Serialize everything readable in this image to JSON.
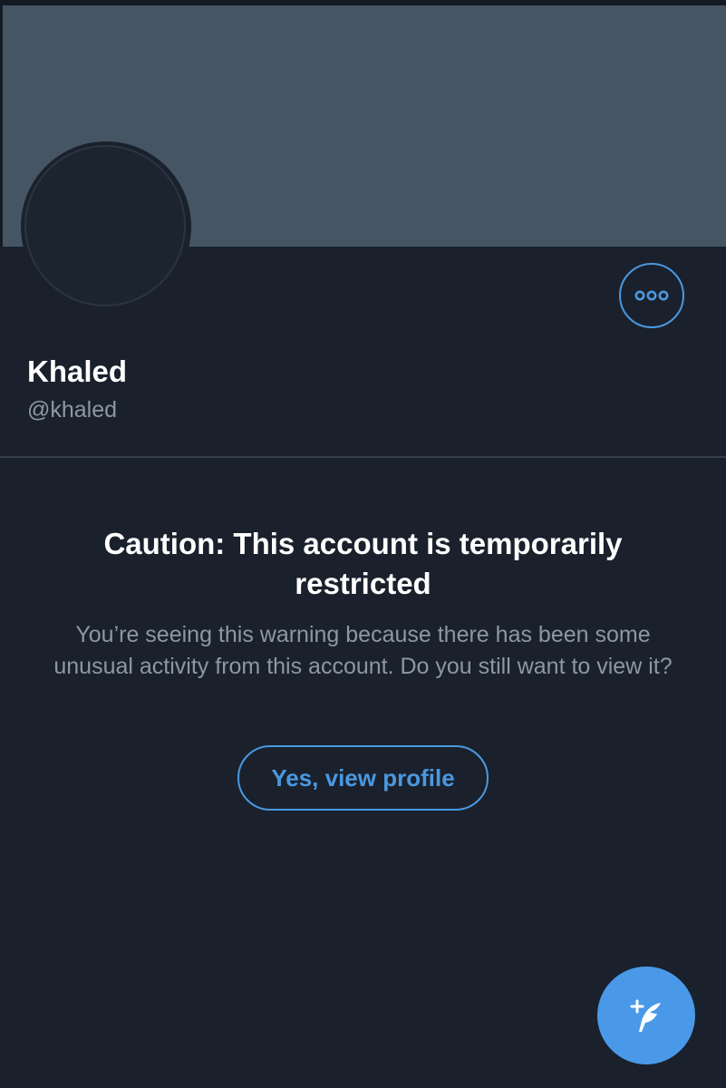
{
  "profile": {
    "display_name": "Khaled",
    "handle": "@khaled"
  },
  "warning": {
    "title": "Caution: This account is temporarily restricted",
    "body": "You’re seeing this warning because there has been some unusual activity from this account. Do you still want to view it?",
    "button_label": "Yes, view profile"
  },
  "icons": {
    "more": "more-options-icon",
    "compose": "compose-tweet-icon"
  },
  "colors": {
    "background": "#1a212c",
    "banner": "#455564",
    "accent": "#4a98e0",
    "secondary_text": "#8b98a5"
  }
}
